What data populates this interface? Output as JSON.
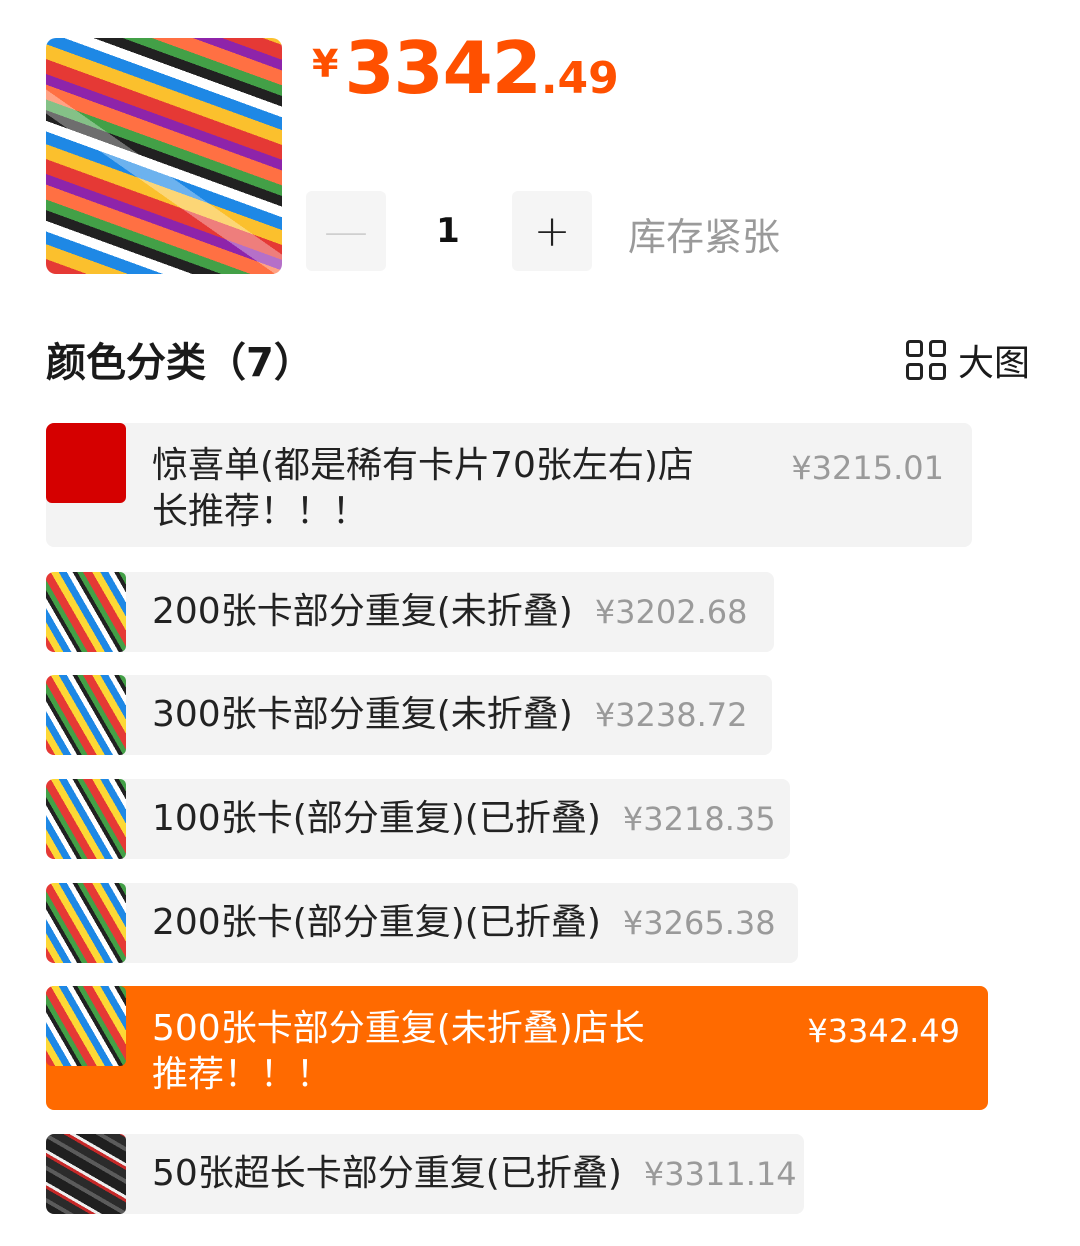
{
  "product": {
    "price_currency": "¥",
    "price_integer": "3342",
    "price_decimal": ".49"
  },
  "quantity": {
    "minus_label": "—",
    "value": "1",
    "plus_label": "+",
    "stock_status": "库存紧张"
  },
  "section": {
    "title": "颜色分类（7）",
    "big_image_label": "大图",
    "big_image_icon": "grid-icon"
  },
  "options": [
    {
      "line1": "惊喜单(都是稀有卡片70张左右)店",
      "line2": "长推荐！！！",
      "price": "¥3215.01"
    },
    {
      "name": "200张卡部分重复(未折叠)",
      "price": "¥3202.68"
    },
    {
      "name": "300张卡部分重复(未折叠)",
      "price": "¥3238.72"
    },
    {
      "name": "100张卡(部分重复)(已折叠)",
      "price": "¥3218.35"
    },
    {
      "name": "200张卡(部分重复)(已折叠)",
      "price": "¥3265.38"
    },
    {
      "line1": "500张卡部分重复(未折叠)店长",
      "line2": "推荐！！！",
      "price": "¥3342.49",
      "selected": true
    },
    {
      "name": "50张超长卡部分重复(已折叠)",
      "price": "¥3311.14"
    }
  ],
  "colors": {
    "accent": "#ff5000",
    "selected_bg": "#ff6a00",
    "option_bg": "#f3f3f3",
    "muted_text": "#9a9a9a"
  }
}
